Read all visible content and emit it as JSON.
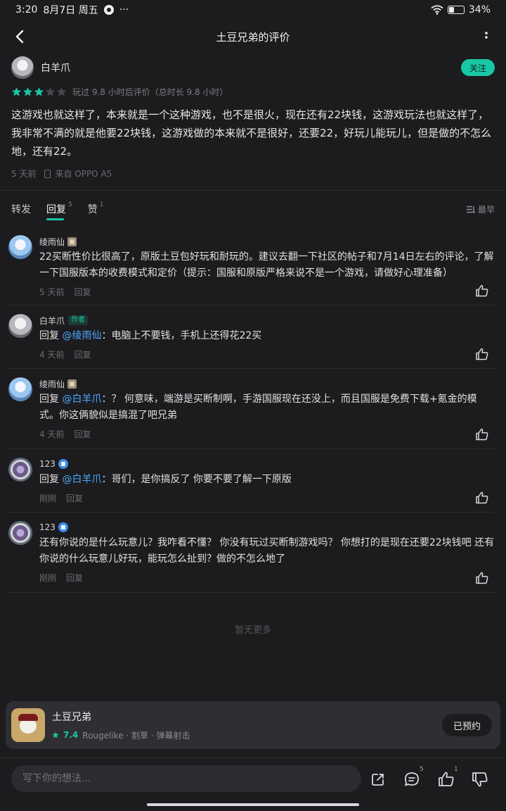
{
  "status_bar": {
    "time": "3:20",
    "date": "8月7日 周五",
    "dots": "···",
    "battery": "34%",
    "battery_level": 0.34
  },
  "header": {
    "title": "土豆兄弟的评价"
  },
  "review": {
    "author": "白羊爪",
    "follow_label": "关注",
    "rating": 3,
    "max_rating": 5,
    "play_info": "玩过 9.8 小时后评价（总时长 9.8 小时）",
    "text": "这游戏也就这样了，本来就是一个这种游戏，也不是很火，现在还有22块钱，这游戏玩法也就这样了，我非常不满的就是他要22块钱，这游戏做的本来就不是很好，还要22，好玩儿能玩儿，但是做的不怎么地，还有22。",
    "time": "5 天前",
    "device": "来自 OPPO A5"
  },
  "tabs": {
    "forward": "转发",
    "reply": "回复",
    "reply_count": "5",
    "like": "赞",
    "like_count": "1",
    "sort": "最早"
  },
  "comments": [
    {
      "author": "绫雨仙",
      "text": "22买断性价比很高了，原版土豆包好玩和耐玩的。建议去翻一下社区的帖子和7月14日左右的评论，了解一下国服版本的收费模式和定价（提示：国服和原版严格来说不是一个游戏，请做好心理准备）",
      "time": "5 天前",
      "reply_label": "回复"
    },
    {
      "author": "白羊爪",
      "tag": "作者",
      "prefix": "回复",
      "mention": "@绫雨仙",
      "text": "：电脑上不要钱，手机上还得花22买",
      "time": "4 天前",
      "reply_label": "回复"
    },
    {
      "author": "绫雨仙",
      "prefix": "回复",
      "mention": "@白羊爪",
      "text": "：？ 何意味，端游是买断制啊，手游国服现在还没上，而且国服是免费下载+氪金的模式。你这俩貌似是搞混了吧兄弟",
      "time": "4 天前",
      "reply_label": "回复"
    },
    {
      "author": "123",
      "prefix": "回复",
      "mention": "@白羊爪",
      "text": "：哥们，是你搞反了 你要不要了解一下原版",
      "time": "刚刚",
      "reply_label": "回复"
    },
    {
      "author": "123",
      "text": "还有你说的是什么玩意儿？我咋看不懂？ 你没有玩过买断制游戏吗？ 你想打的是现在还要22块钱吧 还有你说的什么玩意儿好玩，能玩怎么扯到？做的不怎么地了",
      "time": "刚刚",
      "reply_label": "回复"
    }
  ],
  "no_more": "暂无更多",
  "game": {
    "name": "土豆兄弟",
    "score": "7.4",
    "tags": "Rougelike · 割草 · 弹幕射击",
    "button": "已预约"
  },
  "bottom": {
    "placeholder": "写下你的想法...",
    "comment_count": "5",
    "like_count": "1"
  },
  "colors": {
    "accent": "#18c7a4",
    "mention": "#4aa8ff",
    "background": "#1c1c1e"
  }
}
